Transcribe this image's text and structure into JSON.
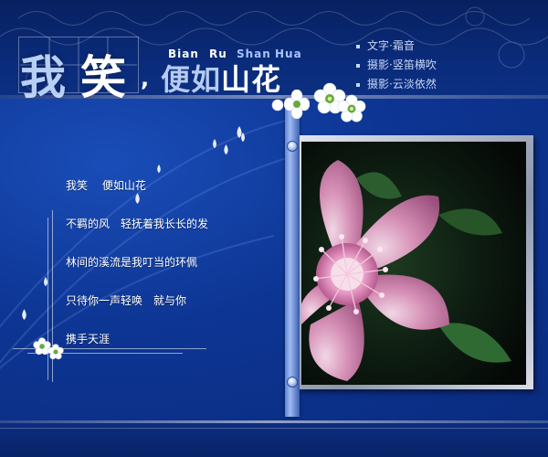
{
  "header": {
    "title_char_1": "我",
    "title_char_2": "笑",
    "title_punct": ",",
    "subtitle_1": "便",
    "subtitle_2": "如",
    "subtitle_3": "山",
    "subtitle_4": "花",
    "pinyin_1": "Bian",
    "pinyin_2": "Ru",
    "pinyin_3": "Shan",
    "pinyin_4": "Hua"
  },
  "credits": [
    "文字·霜音",
    "摄影·竖笛横吹",
    "摄影·云淡依然"
  ],
  "poem": {
    "lines": [
      "我笑　 便如山花",
      "不羁的风　轻抚着我长长的发",
      "林间的溪流是我叮当的环佩",
      "只待你一声轻唤　就与你",
      "携手天涯"
    ]
  },
  "colors": {
    "header_bg": "#0a2b7a",
    "content_bg": "#0d3593",
    "accent_light": "#a8c3ff",
    "text": "#ffffff"
  },
  "icons": {
    "flower": "white-blossom-icon",
    "drop": "water-drop-icon",
    "knob": "pole-knob-icon"
  }
}
